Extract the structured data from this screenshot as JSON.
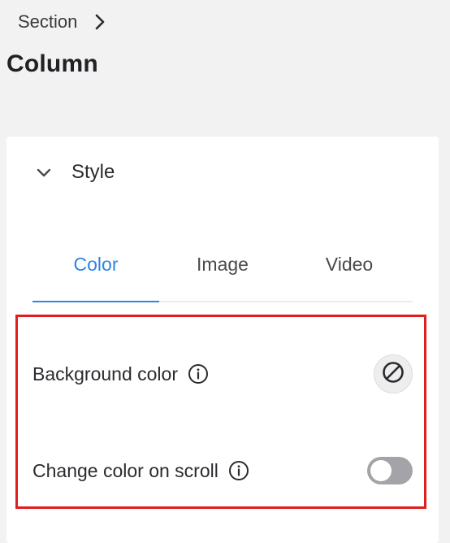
{
  "breadcrumb": {
    "section_label": "Section",
    "separator_icon": "chevron-right-icon"
  },
  "page": {
    "title": "Column"
  },
  "style_panel": {
    "header_label": "Style",
    "collapse_icon": "chevron-down-icon",
    "expanded": true,
    "tabs": [
      {
        "label": "Color",
        "active": true
      },
      {
        "label": "Image",
        "active": false
      },
      {
        "label": "Video",
        "active": false
      }
    ],
    "settings": {
      "background_color": {
        "label": "Background color",
        "info_icon": "info-icon",
        "value_icon": "no-color-icon"
      },
      "change_color_on_scroll": {
        "label": "Change color on scroll",
        "info_icon": "info-icon",
        "enabled": false
      }
    }
  },
  "colors": {
    "accent": "#2d86e0",
    "highlight_border": "#e01e1e",
    "toggle_off": "#a4a4a8",
    "page_background": "#f2f2f3"
  }
}
